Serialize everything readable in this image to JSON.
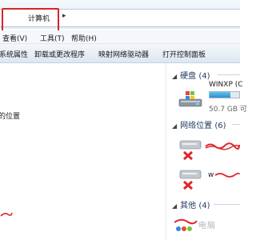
{
  "window": {
    "address_text": "计算机",
    "address_chevron": "▸"
  },
  "menu": {
    "items": [
      "查看(V)",
      "工具(T)",
      "帮助(H)"
    ]
  },
  "toolbar": {
    "items": [
      "系统属性",
      "卸载或更改程序",
      "映射网络驱动器",
      "打开控制面板"
    ]
  },
  "nav": {
    "location_fragment": "的位置"
  },
  "sections": {
    "hard_disk": {
      "label": "硬盘 (4)"
    },
    "network_location": {
      "label": "网络位置 (6)"
    },
    "other": {
      "label": "其他 (4)"
    }
  },
  "drive": {
    "name": "WINXP (C",
    "free_text": "50.7 GB 可",
    "usage_fraction": 0.7
  },
  "network_items": [
    {
      "label_partial": ""
    },
    {
      "label_partial": "w"
    }
  ],
  "watermark": {
    "text": "电脑"
  },
  "colors": {
    "highlight_red": "#d8232a",
    "drive_fill": "#2b8fd0",
    "section_text": "#1e3a5f"
  },
  "icons": {
    "tri": "◢",
    "chevron": "▸"
  }
}
